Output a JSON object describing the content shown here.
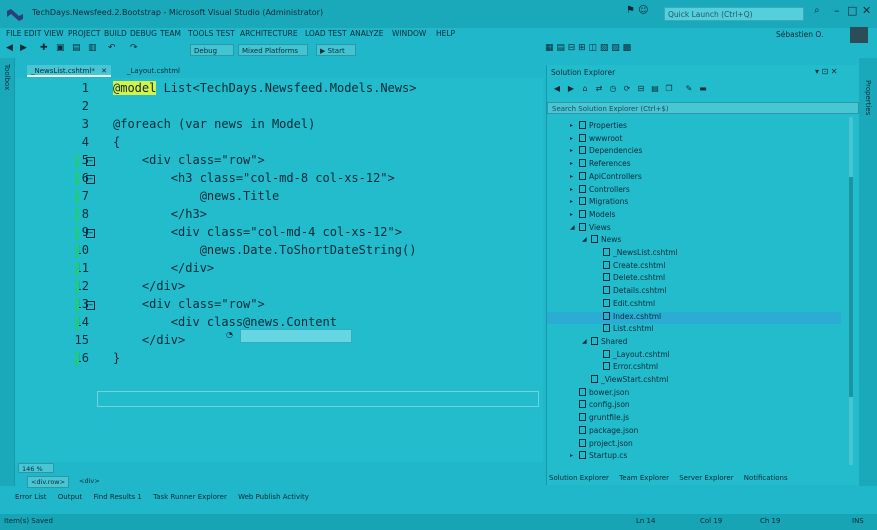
{
  "window": {
    "title": "TechDays.Newsfeed.2.Bootstrap - Microsoft Visual Studio (Administrator)",
    "quick_launch_placeholder": "Quick Launch (Ctrl+Q)",
    "user": "Sébastien O."
  },
  "menu": [
    "FILE",
    "EDIT",
    "VIEW",
    "PROJECT",
    "BUILD",
    "DEBUG",
    "TEAM",
    "TOOLS",
    "TEST",
    "ARCHITECTURE",
    "LOAD TEST",
    "ANALYZE",
    "WINDOW",
    "HELP"
  ],
  "toolbar": {
    "config": "Debug",
    "platform": "Mixed Platforms",
    "start": "Start"
  },
  "side_strips": {
    "left": "Toolbox",
    "right": "Properties"
  },
  "editor": {
    "tabs": [
      {
        "label": "_NewsList.cshtml*",
        "active": true
      },
      {
        "label": "_Layout.cshtml",
        "active": false
      }
    ],
    "lines": [
      {
        "n": "1",
        "text": "@model List<TechDays.Newsfeed.Models.News>"
      },
      {
        "n": "2",
        "text": ""
      },
      {
        "n": "3",
        "text": "@foreach (var news in Model)"
      },
      {
        "n": "4",
        "text": "{"
      },
      {
        "n": "5",
        "text": "    <div class=\"row\">"
      },
      {
        "n": "6",
        "text": "        <h3 class=\"col-md-8 col-xs-12\">"
      },
      {
        "n": "7",
        "text": "            @news.Title"
      },
      {
        "n": "8",
        "text": "        </h3>"
      },
      {
        "n": "9",
        "text": "        <div class=\"col-md-4 col-xs-12\">"
      },
      {
        "n": "10",
        "text": "            @news.Date.ToShortDateString()"
      },
      {
        "n": "11",
        "text": "        </div>"
      },
      {
        "n": "12",
        "text": "    </div>"
      },
      {
        "n": "13",
        "text": "    <div class=\"row\">"
      },
      {
        "n": "14",
        "text": "        <div class@news.Content"
      },
      {
        "n": "15",
        "text": "    </div>"
      },
      {
        "n": "16",
        "text": "}"
      }
    ],
    "zoom": "146 %",
    "breadcrumb": [
      "<div.row>",
      "<div>"
    ]
  },
  "solution_explorer": {
    "title": "Solution Explorer",
    "search_placeholder": "Search Solution Explorer (Ctrl+$)",
    "items": [
      {
        "label": "Properties",
        "depth": 0,
        "expander": "▸"
      },
      {
        "label": "wwwroot",
        "depth": 0,
        "expander": "▸"
      },
      {
        "label": "Dependencies",
        "depth": 0,
        "expander": "▸"
      },
      {
        "label": "References",
        "depth": 0,
        "expander": "▸"
      },
      {
        "label": "ApiControllers",
        "depth": 0,
        "expander": "▸"
      },
      {
        "label": "Controllers",
        "depth": 0,
        "expander": "▸"
      },
      {
        "label": "Migrations",
        "depth": 0,
        "expander": "▸"
      },
      {
        "label": "Models",
        "depth": 0,
        "expander": "▸"
      },
      {
        "label": "Views",
        "depth": 0,
        "expander": "◢"
      },
      {
        "label": "News",
        "depth": 1,
        "expander": "◢"
      },
      {
        "label": "_NewsList.cshtml",
        "depth": 2,
        "expander": ""
      },
      {
        "label": "Create.cshtml",
        "depth": 2,
        "expander": ""
      },
      {
        "label": "Delete.cshtml",
        "depth": 2,
        "expander": ""
      },
      {
        "label": "Details.cshtml",
        "depth": 2,
        "expander": ""
      },
      {
        "label": "Edit.cshtml",
        "depth": 2,
        "expander": ""
      },
      {
        "label": "Index.cshtml",
        "depth": 2,
        "expander": ""
      },
      {
        "label": "List.cshtml",
        "depth": 2,
        "expander": ""
      },
      {
        "label": "Shared",
        "depth": 1,
        "expander": "◢"
      },
      {
        "label": "_Layout.cshtml",
        "depth": 2,
        "expander": ""
      },
      {
        "label": "Error.cshtml",
        "depth": 2,
        "expander": ""
      },
      {
        "label": "_ViewStart.cshtml",
        "depth": 1,
        "expander": ""
      },
      {
        "label": "bower.json",
        "depth": 0,
        "expander": ""
      },
      {
        "label": "config.json",
        "depth": 0,
        "expander": ""
      },
      {
        "label": "gruntfile.js",
        "depth": 0,
        "expander": ""
      },
      {
        "label": "package.json",
        "depth": 0,
        "expander": ""
      },
      {
        "label": "project.json",
        "depth": 0,
        "expander": ""
      },
      {
        "label": "Startup.cs",
        "depth": 0,
        "expander": "▸"
      }
    ],
    "tabs": [
      "Solution Explorer",
      "Team Explorer",
      "Server Explorer",
      "Notifications"
    ]
  },
  "bottom_tabs": [
    "Error List",
    "Output",
    "Find Results 1",
    "Task Runner Explorer",
    "Web Publish Activity"
  ],
  "status": {
    "message": "Item(s) Saved",
    "ln": "Ln 14",
    "col": "Col 19",
    "ch": "Ch 19",
    "mode": "INS"
  },
  "colors": {
    "background": "#1fb7c9",
    "gutter_changed": "#1ec98a",
    "highlight": "#d5f247"
  }
}
